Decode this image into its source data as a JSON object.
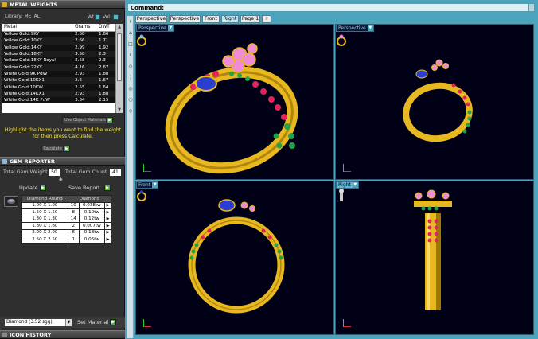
{
  "metal_weights": {
    "title": "METAL WEIGHTS",
    "library_label": "Library: METAL",
    "wt_label": "Wt",
    "vol_label": "Vol",
    "columns": [
      "Metal",
      "Grams",
      "DWT"
    ],
    "rows": [
      [
        "Yellow Gold:9KY",
        "2.58",
        "1.66"
      ],
      [
        "Yellow Gold:10KY",
        "2.66",
        "1.71"
      ],
      [
        "Yellow Gold:14KY",
        "2.99",
        "1.92"
      ],
      [
        "Yellow Gold:18KY",
        "3.58",
        "2.3"
      ],
      [
        "Yellow Gold:18KY Royal",
        "3.58",
        "2.3"
      ],
      [
        "Yellow Gold:22KY",
        "4.16",
        "2.67"
      ],
      [
        "White Gold:9K PdW",
        "2.93",
        "1.88"
      ],
      [
        "White Gold:10KX1",
        "2.6",
        "1.67"
      ],
      [
        "White Gold:10KW",
        "2.55",
        "1.64"
      ],
      [
        "White Gold:14KX1",
        "2.93",
        "1.88"
      ],
      [
        "White Gold:14K PdW",
        "3.34",
        "2.15"
      ]
    ],
    "use_object_materials": "Use Object Materials",
    "hint": "Highlight the items you want to find the weight for then press Calculate.",
    "calculate_label": "Calculate"
  },
  "gem_reporter": {
    "title": "GEM REPORTER",
    "total_gem_weight_label": "Total Gem Weight",
    "total_gem_weight": "50",
    "total_gem_count_label": "Total Gem Count",
    "total_gem_count": "41",
    "update_label": "Update",
    "save_report_label": "Save Report",
    "columns": [
      "Diamond Round",
      "Diamond"
    ],
    "rows": [
      [
        "1.00 X 1.00",
        "10",
        "0.038tw"
      ],
      [
        "1.50 X 1.50",
        "8",
        "0.10tw"
      ],
      [
        "1.30 X 1.30",
        "14",
        "0.12tw"
      ],
      [
        "1.80 X 1.80",
        "2",
        "0.007tw"
      ],
      [
        "2.00 X 2.00",
        "6",
        "0.18tw"
      ],
      [
        "2.50 X 2.50",
        "1",
        "0.06tw"
      ]
    ],
    "material_value": "Diamond    (3.52 sgg)",
    "set_material_label": "Set Material"
  },
  "icon_history": {
    "title": "ICON HISTORY"
  },
  "command": {
    "label": "Command:"
  },
  "tabs": [
    "Perspective",
    "Perspective",
    "Front",
    "Right",
    "Page 1",
    "+"
  ],
  "active_tab_index": 3,
  "viewports": [
    {
      "label": "Perspective"
    },
    {
      "label": "Perspective"
    },
    {
      "label": "Front"
    },
    {
      "label": "Right"
    }
  ],
  "colors": {
    "gold": "#e8b820",
    "accent": "#4aa4bd",
    "ruby": "#e0245a",
    "emerald": "#22a24a",
    "sapphire": "#2a3fd0",
    "pink": "#f08bd6",
    "viewport_bg": "#000016",
    "hint": "#f2e04b",
    "go_button": "#5aa63a"
  }
}
